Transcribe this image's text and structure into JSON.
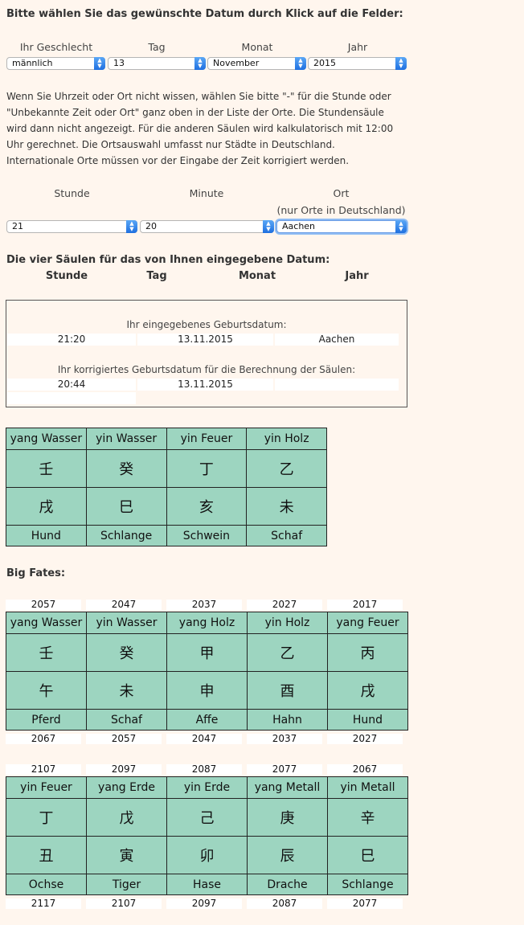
{
  "heading_select": "Bitte wählen Sie das gewünschte Datum durch Klick auf die Felder:",
  "form1": {
    "labels": [
      "Ihr Geschlecht",
      "Tag",
      "Monat",
      "Jahr"
    ],
    "values": [
      "männlich",
      "13",
      "November",
      "2015"
    ]
  },
  "info_text": "Wenn Sie Uhrzeit oder Ort nicht wissen, wählen Sie bitte \"-\" für die Stunde oder \"Unbekannte Zeit oder Ort\" ganz oben in der Liste der Orte. Die Stundensäule wird dann nicht angezeigt. Für die anderen Säulen wird kalkulatorisch mit 12:00 Uhr gerechnet. Die Ortsauswahl umfasst nur Städte in Deutschland. Internationale Orte müssen vor der Eingabe der Zeit korrigiert werden.",
  "form2": {
    "labels": [
      "Stunde",
      "Minute",
      "Ort"
    ],
    "ort_note": "(nur Orte in Deutschland)",
    "values": [
      "21",
      "20",
      "Aachen"
    ]
  },
  "pillars_heading": "Die vier Säulen für das von Ihnen eingegebene Datum:",
  "pillar_headers": [
    "Stunde",
    "Tag",
    "Monat",
    "Jahr"
  ],
  "datebox": {
    "entered_label": "Ihr eingegebenes Geburtsdatum:",
    "entered_time": "21:20",
    "entered_date": "13.11.2015",
    "entered_place": "Aachen",
    "corrected_label": "Ihr korrigiertes Geburtsdatum für die Berechnung der Säulen:",
    "corrected_time": "20:44",
    "corrected_date": "13.11.2015"
  },
  "four_pillars": {
    "names": [
      "yang Wasser",
      "yin Wasser",
      "yin Feuer",
      "yin Holz"
    ],
    "stems": [
      "壬",
      "癸",
      "丁",
      "乙"
    ],
    "branches": [
      "戌",
      "巳",
      "亥",
      "未"
    ],
    "animals": [
      "Hund",
      "Schlange",
      "Schwein",
      "Schaf"
    ]
  },
  "big_fates_heading": "Big Fates:",
  "big_fates": [
    {
      "top_years": [
        "2057",
        "2047",
        "2037",
        "2027",
        "2017"
      ],
      "names": [
        "yang Wasser",
        "yin Wasser",
        "yang Holz",
        "yin Holz",
        "yang Feuer"
      ],
      "stems": [
        "壬",
        "癸",
        "甲",
        "乙",
        "丙"
      ],
      "branches": [
        "午",
        "未",
        "申",
        "酉",
        "戌"
      ],
      "animals": [
        "Pferd",
        "Schaf",
        "Affe",
        "Hahn",
        "Hund"
      ],
      "bottom_years": [
        "2067",
        "2057",
        "2047",
        "2037",
        "2027"
      ]
    },
    {
      "top_years": [
        "2107",
        "2097",
        "2087",
        "2077",
        "2067"
      ],
      "names": [
        "yin Feuer",
        "yang Erde",
        "yin Erde",
        "yang Metall",
        "yin Metall"
      ],
      "stems": [
        "丁",
        "戊",
        "己",
        "庚",
        "辛"
      ],
      "branches": [
        "丑",
        "寅",
        "卯",
        "辰",
        "巳"
      ],
      "animals": [
        "Ochse",
        "Tiger",
        "Hase",
        "Drache",
        "Schlange"
      ],
      "bottom_years": [
        "2117",
        "2107",
        "2097",
        "2087",
        "2077"
      ]
    }
  ],
  "colors": {
    "background": "#fff6ee",
    "pillar_cell": "#9dd5c0",
    "select_arrow": "#1e6fe0"
  }
}
